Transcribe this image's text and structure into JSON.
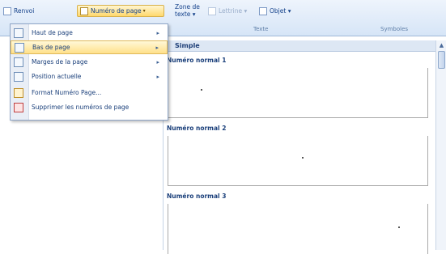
{
  "ribbon": {
    "renvoi_label": "Renvoi",
    "page_number_label": "Numéro de page",
    "text_zone_label": "Zone de texte",
    "lettrine_label": "Lettrine",
    "objet_label": "Objet",
    "group_text": "Texte",
    "group_symbols": "Symboles"
  },
  "menu": {
    "items": [
      {
        "label": "Haut de page",
        "arrow": "▸"
      },
      {
        "label": "Bas de page",
        "arrow": "▸"
      },
      {
        "label": "Marges de la page",
        "arrow": "▸"
      },
      {
        "label": "Position actuelle",
        "arrow": "▸"
      },
      {
        "label": "Format Numéro Page...",
        "arrow": ""
      },
      {
        "label": "Supprimer les numéros de page",
        "arrow": ""
      }
    ],
    "selected_index": 1
  },
  "gallery": {
    "header": "Simple",
    "options": [
      {
        "title": "Numéro normal 1",
        "number": "1",
        "align": "left"
      },
      {
        "title": "Numéro normal 2",
        "number": "1",
        "align": "center"
      },
      {
        "title": "Numéro normal 3",
        "number": "1",
        "align": "right"
      }
    ]
  }
}
